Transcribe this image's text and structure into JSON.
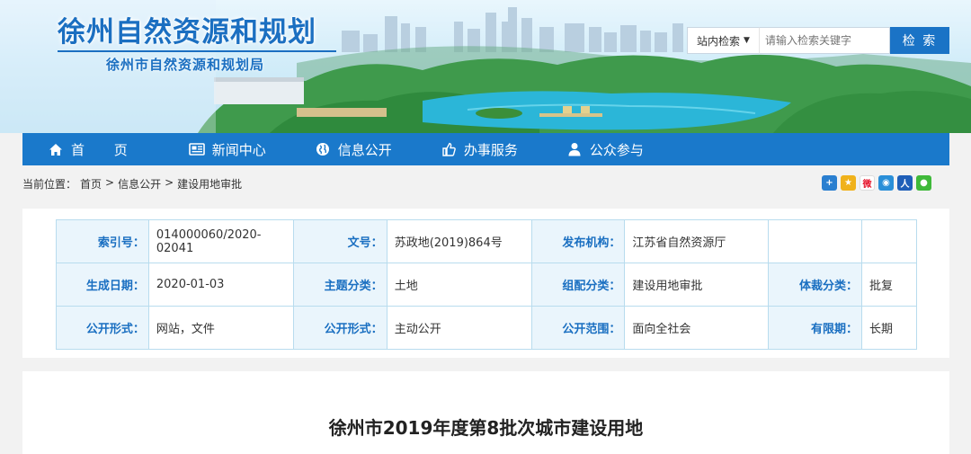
{
  "header": {
    "title": "徐州自然资源和规划",
    "subtitle": "徐州市自然资源和规划局"
  },
  "search": {
    "scope_label": "站内检索",
    "placeholder": "请输入检索关键字",
    "button_label": "检 索"
  },
  "nav": {
    "items": [
      {
        "label": "首 页",
        "icon": "home-icon"
      },
      {
        "label": "新闻中心",
        "icon": "newspaper-icon"
      },
      {
        "label": "信息公开",
        "icon": "globe-icon"
      },
      {
        "label": "办事服务",
        "icon": "thumbs-up-icon"
      },
      {
        "label": "公众参与",
        "icon": "user-icon"
      }
    ]
  },
  "breadcrumb": {
    "prefix": "当前位置：",
    "items": [
      "首页",
      "信息公开",
      "建设用地审批"
    ],
    "separator": ">"
  },
  "share_icons": [
    "plus-share-icon",
    "qzone-icon",
    "weibo-icon",
    "tencent-weibo-icon",
    "renren-icon",
    "wechat-icon"
  ],
  "meta": {
    "rows": [
      [
        {
          "k": "索引号：",
          "v": "014000060/2020-02041"
        },
        {
          "k": "文号：",
          "v": "苏政地(2019)864号"
        },
        {
          "k": "发布机构：",
          "v": "江苏省自然资源厅"
        },
        {
          "k": "",
          "v": ""
        }
      ],
      [
        {
          "k": "生成日期：",
          "v": "2020-01-03"
        },
        {
          "k": "主题分类：",
          "v": "土地"
        },
        {
          "k": "组配分类：",
          "v": "建设用地审批"
        },
        {
          "k": "体裁分类：",
          "v": "批复"
        }
      ],
      [
        {
          "k": "公开形式：",
          "v": "网站，文件"
        },
        {
          "k": "公开形式：",
          "v": "主动公开"
        },
        {
          "k": "公开范围：",
          "v": "面向全社会"
        },
        {
          "k": "有限期：",
          "v": "长期"
        }
      ]
    ]
  },
  "article": {
    "title": "徐州市2019年度第8批次城市建设用地"
  },
  "colors": {
    "brand_blue": "#1a79cb",
    "title_blue": "#1b6fc1",
    "table_border": "#b8dcee",
    "key_bg": "#eaf5fc"
  }
}
